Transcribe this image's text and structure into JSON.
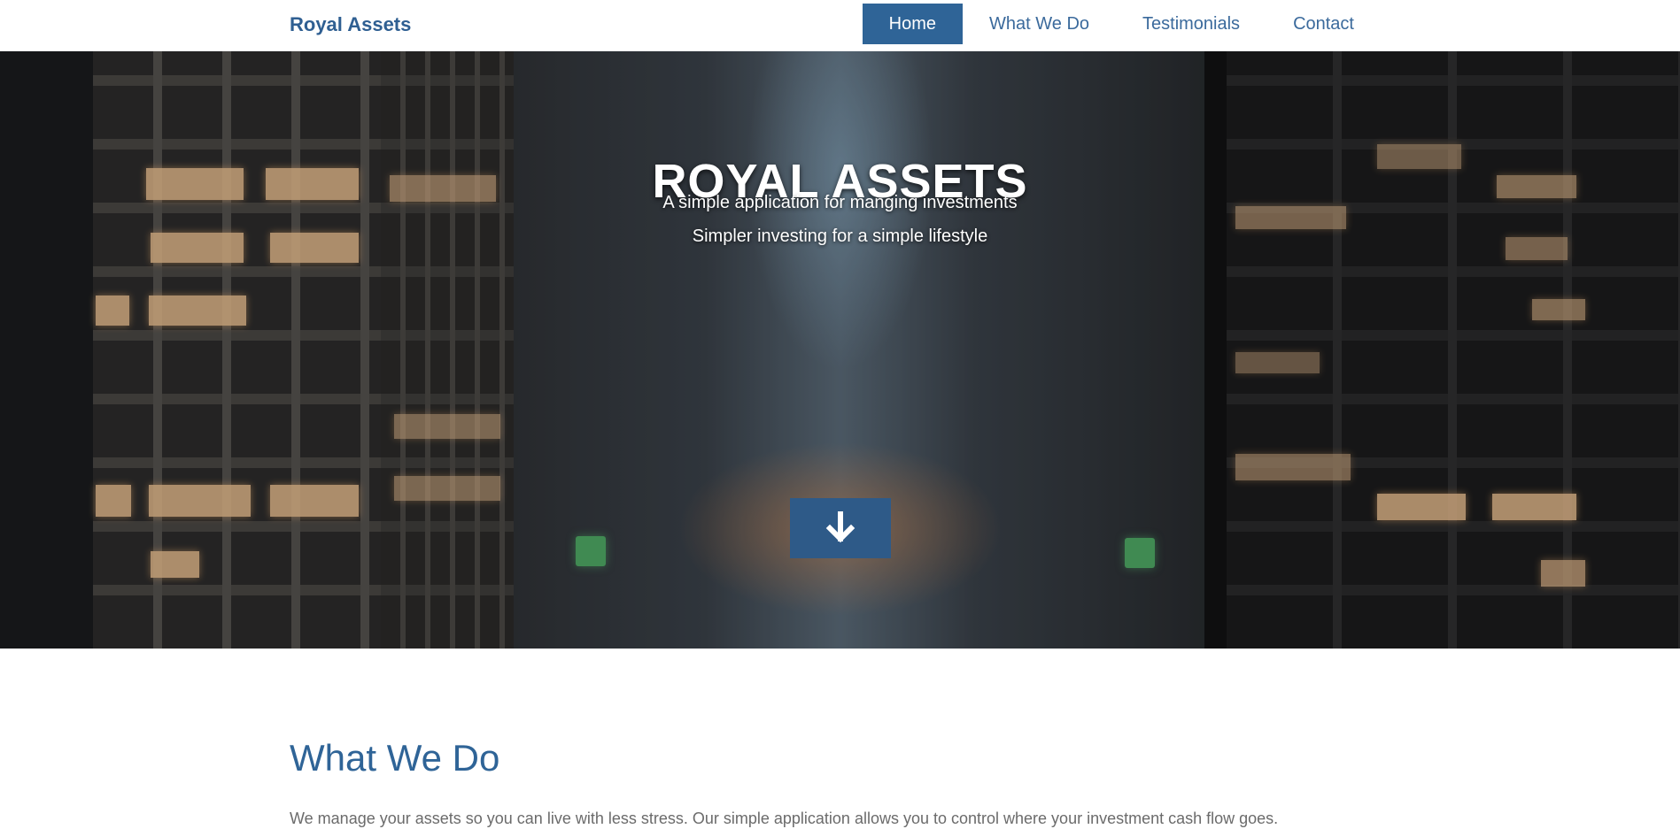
{
  "navbar": {
    "brand": "Royal Assets",
    "items": [
      {
        "label": "Home",
        "active": true
      },
      {
        "label": "What We Do",
        "active": false
      },
      {
        "label": "Testimonials",
        "active": false
      },
      {
        "label": "Contact",
        "active": false
      }
    ]
  },
  "hero": {
    "title": "ROYAL ASSETS",
    "subtitle_1": "A simple application for manging investments",
    "subtitle_2": "Simpler investing for a simple lifestyle",
    "scroll_icon": "arrow-down-icon",
    "image_description_icon": "city-background"
  },
  "section": {
    "title": "What We Do",
    "text": "We manage your assets so you can live with less stress. Our simple application allows you to control where your investment cash flow goes."
  },
  "colors": {
    "brand": "#2f5f92",
    "nav_active_bg": "#2f6497",
    "scroll_button": "#2e5a88",
    "section_title": "#2f6497"
  }
}
